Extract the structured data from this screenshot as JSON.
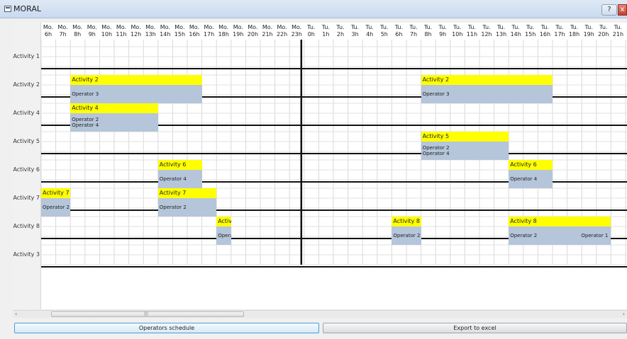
{
  "window": {
    "title": "MORAL",
    "help_label": "?",
    "close_label": "x"
  },
  "headers": [
    [
      "Mo.",
      "6h"
    ],
    [
      "Mo.",
      "7h"
    ],
    [
      "Mo.",
      "8h"
    ],
    [
      "Mo.",
      "9h"
    ],
    [
      "Mo.",
      "10h"
    ],
    [
      "Mo.",
      "11h"
    ],
    [
      "Mo.",
      "12h"
    ],
    [
      "Mo.",
      "13h"
    ],
    [
      "Mo.",
      "14h"
    ],
    [
      "Mo.",
      "15h"
    ],
    [
      "Mo.",
      "16h"
    ],
    [
      "Mo.",
      "17h"
    ],
    [
      "Mo.",
      "18h"
    ],
    [
      "Mo.",
      "19h"
    ],
    [
      "Mo.",
      "20h"
    ],
    [
      "Mo.",
      "21h"
    ],
    [
      "Mo.",
      "22h"
    ],
    [
      "Mo.",
      "23h"
    ],
    [
      "Tu.",
      "0h"
    ],
    [
      "Tu.",
      "1h"
    ],
    [
      "Tu.",
      "2h"
    ],
    [
      "Tu.",
      "3h"
    ],
    [
      "Tu.",
      "4h"
    ],
    [
      "Tu.",
      "5h"
    ],
    [
      "Tu.",
      "6h"
    ],
    [
      "Tu.",
      "7h"
    ],
    [
      "Tu.",
      "8h"
    ],
    [
      "Tu.",
      "9h"
    ],
    [
      "Tu.",
      "10h"
    ],
    [
      "Tu.",
      "11h"
    ],
    [
      "Tu.",
      "12h"
    ],
    [
      "Tu.",
      "13h"
    ],
    [
      "Tu.",
      "14h"
    ],
    [
      "Tu.",
      "15h"
    ],
    [
      "Tu.",
      "16h"
    ],
    [
      "Tu.",
      "17h"
    ],
    [
      "Tu.",
      "18h"
    ],
    [
      "Tu.",
      "19h"
    ],
    [
      "Tu.",
      "20h"
    ],
    [
      "Tu.",
      "21h"
    ],
    [
      "Tu.",
      ""
    ]
  ],
  "rows": [
    {
      "label": "Activity 1",
      "blocks": []
    },
    {
      "label": "Activity 2",
      "blocks": [
        {
          "activity": "Activity 2",
          "start": 2,
          "span": 9,
          "operators": [
            "Operator 3"
          ]
        },
        {
          "activity": "Activity 2",
          "start": 26,
          "span": 9,
          "operators": [
            "Operator 3"
          ]
        }
      ]
    },
    {
      "label": "Activity 4",
      "blocks": [
        {
          "activity": "Activity 4",
          "start": 2,
          "span": 6,
          "operators": [
            "Operator 2",
            "Operator 4"
          ]
        }
      ]
    },
    {
      "label": "Activity 5",
      "blocks": [
        {
          "activity": "Activity 5",
          "start": 26,
          "span": 6,
          "operators": [
            "Operator 2",
            "Operator 4"
          ]
        }
      ]
    },
    {
      "label": "Activity 6",
      "blocks": [
        {
          "activity": "Activity 6",
          "start": 8,
          "span": 3,
          "operators": [
            "Operator 4"
          ]
        },
        {
          "activity": "Activity 6",
          "start": 32,
          "span": 3,
          "operators": [
            "Operator 4"
          ]
        }
      ]
    },
    {
      "label": "Activity 7",
      "blocks": [
        {
          "activity": "Activity 7",
          "start": 0,
          "span": 2,
          "operators": [
            "Operator 2"
          ]
        },
        {
          "activity": "Activity 7",
          "start": 8,
          "span": 4,
          "operators": [
            "Operator 2"
          ]
        }
      ]
    },
    {
      "label": "Activity 8",
      "blocks": [
        {
          "activity": "Activity 8",
          "start": 12,
          "span": 1,
          "operators": [
            "Operator 1"
          ]
        },
        {
          "activity": "Activity 8",
          "start": 24,
          "span": 2,
          "operators": [
            "Operator 2"
          ]
        },
        {
          "activity": "Activity 8",
          "start": 32,
          "span": 7,
          "operators": [
            "Operator 2"
          ],
          "operators_right": "Operator 1"
        }
      ]
    },
    {
      "label": "Activity 3",
      "blocks": []
    }
  ],
  "block_labels": {
    "activity_8_short": "Activit",
    "operator_1_short": "Operat"
  },
  "scrollbar": {
    "left_arrow": "‹",
    "right_arrow": "›",
    "grip": "|||"
  },
  "buttons": {
    "operators_schedule": "Operators schedule",
    "export_excel": "Export to excel"
  }
}
